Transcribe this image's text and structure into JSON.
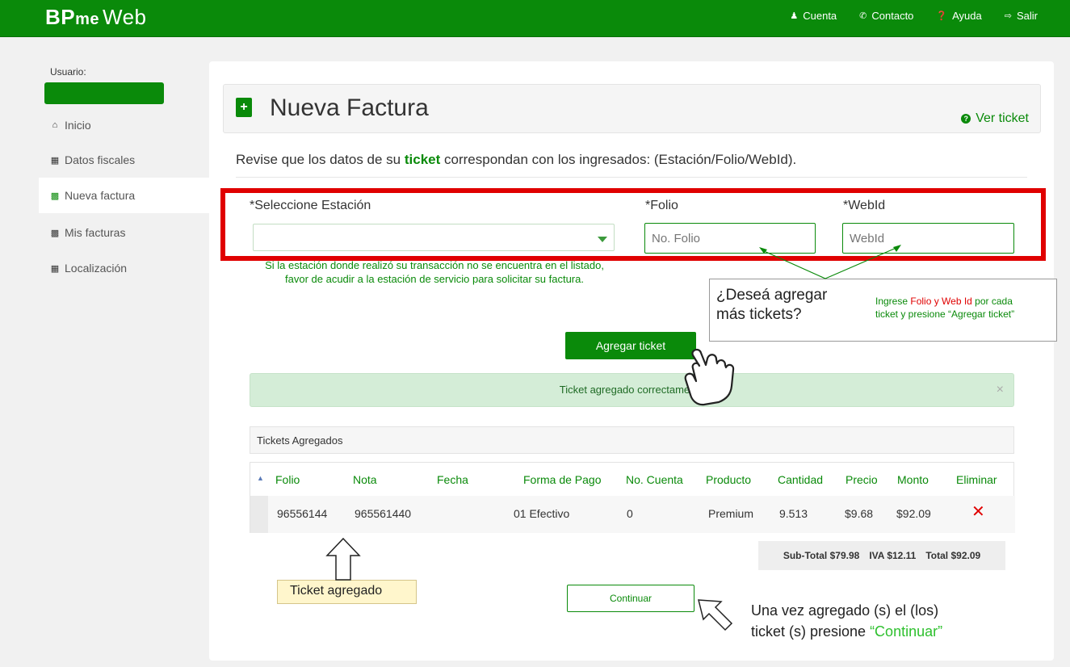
{
  "brand": {
    "part1": "BP",
    "part2": "me",
    "part3": "Web"
  },
  "topnav": [
    {
      "icon": "user-icon",
      "label": "Cuenta"
    },
    {
      "icon": "phone-icon",
      "label": "Contacto"
    },
    {
      "icon": "help-icon",
      "label": "Ayuda"
    },
    {
      "icon": "logout-icon",
      "label": "Salir"
    }
  ],
  "sidebar": {
    "user_label": "Usuario:",
    "items": [
      {
        "icon": "home-icon",
        "label": "Inicio",
        "active": false
      },
      {
        "icon": "building-icon",
        "label": "Datos fiscales",
        "active": false
      },
      {
        "icon": "file-plus-icon",
        "label": "Nueva factura",
        "active": true
      },
      {
        "icon": "file-icon",
        "label": "Mis facturas",
        "active": false
      },
      {
        "icon": "gas-pump-icon",
        "label": "Localización",
        "active": false
      }
    ]
  },
  "main": {
    "title": "Nueva Factura",
    "ver_ticket": "Ver ticket",
    "instructions": {
      "before": "Revise que los datos de su ",
      "highlight": "ticket",
      "after": " correspondan con los ingresados: (Estación/Folio/WebId)."
    },
    "form": {
      "station_label": "*Seleccione Estación",
      "folio_label": "*Folio",
      "webid_label": "*WebId",
      "folio_placeholder": "No. Folio",
      "webid_placeholder": "WebId",
      "station_note": "Si la estación donde realizó su transacción no se encuentra en el listado, favor de acudir a la estación de servicio para solicitar su factura."
    },
    "agregar_button": "Agregar ticket",
    "alert_text": "Ticket agregado correctamente",
    "alert_close": "×",
    "tickets_header": "Tickets Agregados",
    "table": {
      "columns": [
        "Folio",
        "Nota",
        "Fecha",
        "Forma de Pago",
        "No. Cuenta",
        "Producto",
        "Cantidad",
        "Precio",
        "Monto",
        "Eliminar"
      ],
      "rows": [
        {
          "folio": "96556144",
          "nota": "965561440",
          "fecha": "",
          "forma_pago": "01 Efectivo",
          "no_cuenta": "0",
          "producto": "Premium",
          "cantidad": "9.513",
          "precio": "$9.68",
          "monto": "$92.09",
          "eliminar": "✕"
        }
      ]
    },
    "totals": {
      "subtotal": "Sub-Total $79.98",
      "iva": "IVA $12.11",
      "total": "Total $92.09"
    },
    "continuar_button": "Continuar"
  },
  "annotations": {
    "callout_question_1": "¿Deseá agregar",
    "callout_question_2": "más tickets?",
    "callout_hint": {
      "p1": "Ingrese ",
      "p2": "Folio y Web Id",
      "p3": " por cada",
      "p4": "ticket y presione “Agregar ticket”"
    },
    "ticket_agregado": "Ticket agregado",
    "continuar_note_1": "Una vez agregado (s) el (los)",
    "continuar_note_2": "ticket (s) presione ",
    "continuar_note_3": "“Continuar”"
  },
  "colors": {
    "brand_green": "#0a8a0a",
    "highlight_red": "#e00000",
    "alert_bg": "#d4edd7",
    "note_yellow": "#fff6cc"
  }
}
